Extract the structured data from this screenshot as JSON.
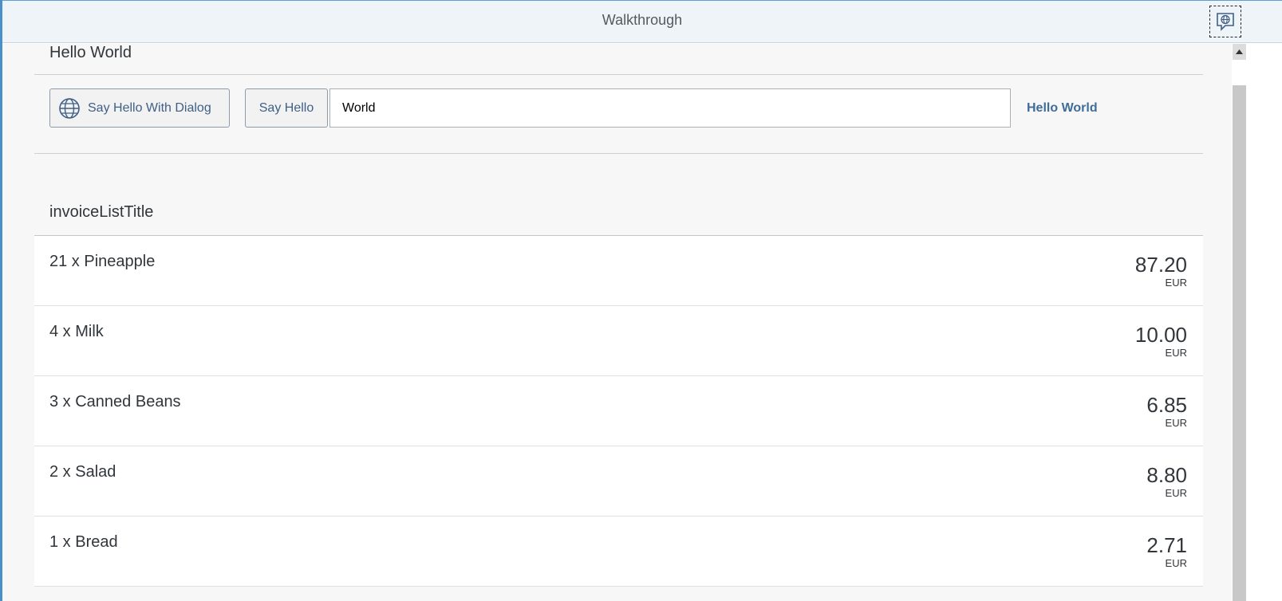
{
  "shellbar": {
    "title": "Walkthrough",
    "icon": "globe-chat-icon"
  },
  "panel": {
    "title": "Hello World",
    "dialog_button": {
      "label": "Say Hello With Dialog",
      "icon": "globe-icon"
    },
    "hello_button": {
      "label": "Say Hello"
    },
    "name_input": {
      "value": "World"
    },
    "hello_text": "Hello World"
  },
  "invoices": {
    "title": "invoiceListTitle",
    "items": [
      {
        "label": "21 x Pineapple",
        "amount": "87.20",
        "currency": "EUR"
      },
      {
        "label": "4 x Milk",
        "amount": "10.00",
        "currency": "EUR"
      },
      {
        "label": "3 x Canned Beans",
        "amount": "6.85",
        "currency": "EUR"
      },
      {
        "label": "2 x Salad",
        "amount": "8.80",
        "currency": "EUR"
      },
      {
        "label": "1 x Bread",
        "amount": "2.71",
        "currency": "EUR"
      }
    ]
  },
  "colors": {
    "accent": "#3f6d99",
    "shell_bg": "#eff4f9",
    "content_bg": "#f7f7f7"
  }
}
